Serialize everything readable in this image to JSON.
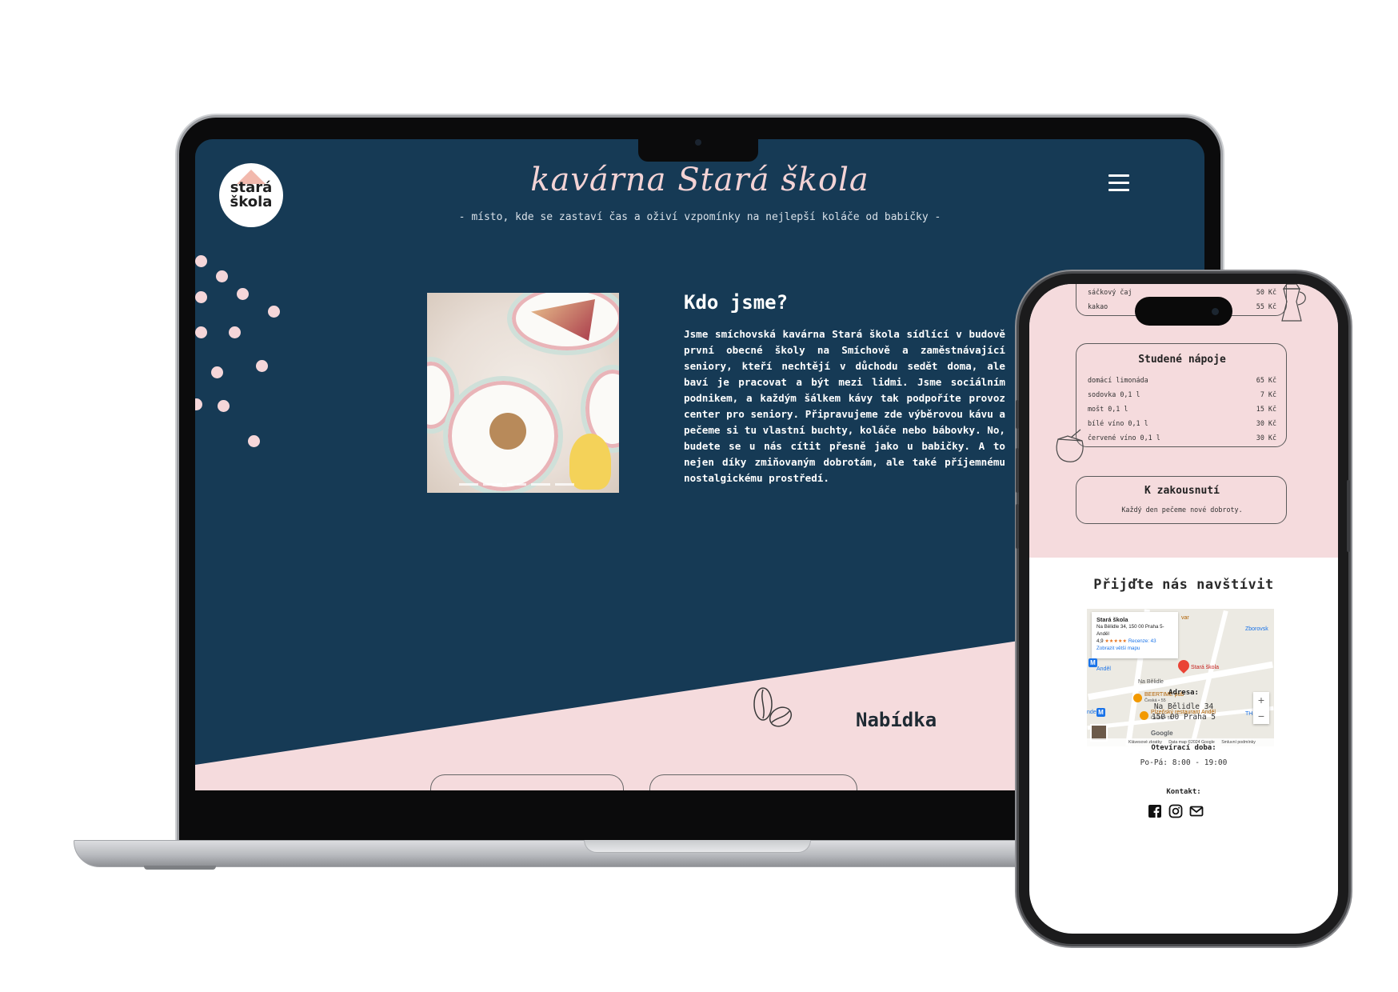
{
  "laptop": {
    "logo": {
      "line1": "stará",
      "line2": "škola"
    },
    "header": {
      "title": "kavárna Stará škola",
      "tagline": "- místo, kde se zastaví čas a oživí vzpomínky na nejlepší koláče od babičky -"
    },
    "icons": {
      "menu": "hamburger-icon",
      "decor": "coffee-bean-icon"
    },
    "about": {
      "heading": "Kdo jsme?",
      "text": "Jsme smíchovská kavárna Stará škola sídlící v budově první obecné školy na Smíchově a zaměstnávající seniory, kteří nechtějí v důchodu sedět doma, ale baví je pracovat a být mezi lidmi. Jsme sociálním podnikem, a každým šálkem kávy tak podpoříte provoz center pro seniory. Připravujeme zde výběrovou kávu a pečeme si tu vlastní buchty, koláče nebo bábovky. No, budete se u nás cítit přesně jako u babičky. A to nejen díky zmiňovaným dobrotám, ale také příjemnému nostalgickému prostředí."
    },
    "offer_heading": "Nabídka"
  },
  "phone": {
    "hot_drinks_tail": [
      {
        "name": "sáčkový čaj",
        "price": "50 Kč"
      },
      {
        "name": "kakao",
        "price": "55 Kč"
      }
    ],
    "cold_drinks": {
      "title": "Studené nápoje",
      "items": [
        {
          "name": "domácí limonáda",
          "price": "65 Kč"
        },
        {
          "name": "sodovka 0,1 l",
          "price": "7 Kč"
        },
        {
          "name": "mošt 0,1 l",
          "price": "15 Kč"
        },
        {
          "name": "bílé víno 0,1 l",
          "price": "30 Kč"
        },
        {
          "name": "červené víno 0,1 l",
          "price": "30 Kč"
        }
      ]
    },
    "snacks": {
      "title": "K zakousnutí",
      "subtitle": "Každý den pečeme nové dobroty."
    },
    "visit_heading": "Přijďte nás navštívit",
    "map": {
      "place_name": "Stará škola",
      "place_address": "Na Bělidle 34, 150 00 Praha 5-Anděl",
      "rating": "4,9",
      "stars": "★★★★★",
      "reviews": "Recenze: 43",
      "bigger_map": "Zobrazit větší mapu",
      "pin_label": "Stará škola",
      "labels": {
        "zborovska": "Zborovsk",
        "andel": "Anděl",
        "na_belidle": "Na Bělidle",
        "beertime": "BEERTIME pub",
        "ceska": "Česká • 55",
        "plzensky": "Plzeňský restaurant Anděl",
        "ceska2": "Česká • 55",
        "ar": "var",
        "th": "TH",
        "ndel": "ndel"
      },
      "metro": "M",
      "zoom_in": "+",
      "zoom_out": "−",
      "google": "Google",
      "footer": [
        "Klávesové zkratky",
        "Data map ©2024 Google",
        "Smluvní podmínky"
      ]
    },
    "address_label": "Adresa:",
    "address_line1": "Na Bělidle 34",
    "address_line2": "150 00 Praha 5",
    "hours_label": "Otevírací doba:",
    "hours_value": "Po-Pá: 8:00 - 19:00",
    "contact_label": "Kontakt:",
    "social_icons": [
      "facebook-icon",
      "instagram-icon",
      "mail-icon"
    ]
  },
  "colors": {
    "navy": "#163a55",
    "pink": "#f5dbdd",
    "title_pink": "#f3d3d5"
  }
}
